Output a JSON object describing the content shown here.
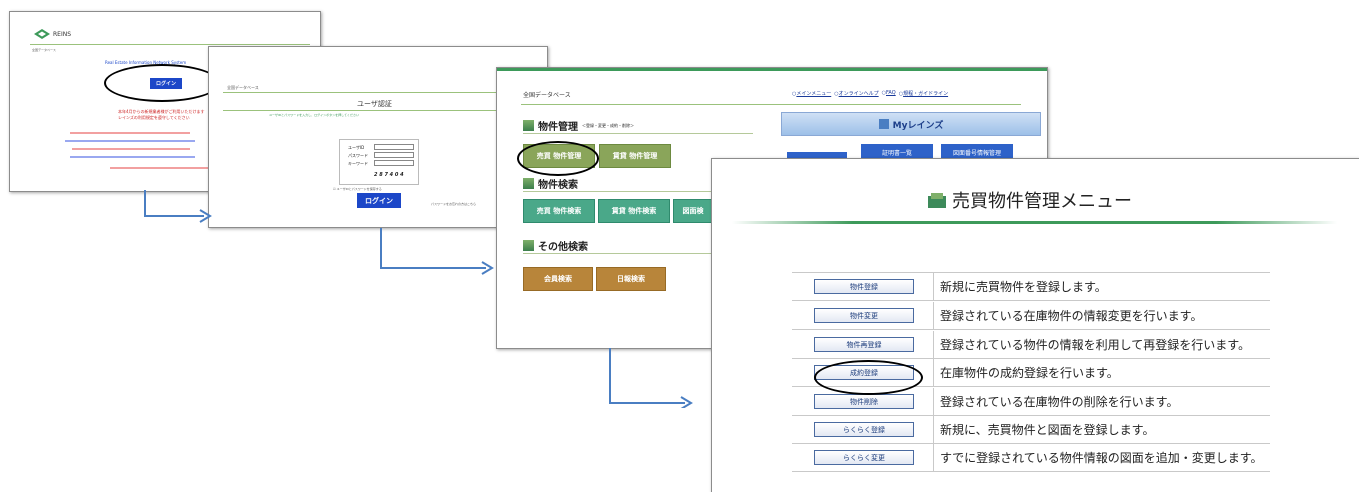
{
  "screen1": {
    "logo": "REINS",
    "header_left": "全国データベース",
    "login_button": "ログイン",
    "body_lines": [
      "Real Estate Information Network System",
      "本年4月からの新規業者様がご利用いただけます",
      "レインズの利用規定を遵守してください"
    ]
  },
  "screen2": {
    "header_left": "全国データベース",
    "title": "ユーザ認証",
    "instruction": "ユーザIDとパスワードを入力し、ログインボタンを押してください",
    "user_id_label": "ユーザID",
    "password_label": "パスワード",
    "keyword_label": "キーワード",
    "captcha": "2 8 7 4 0 4",
    "remember_label": "ユーザIDとパスワードを保存する",
    "login_button": "ログイン",
    "footer_note": "パスワードをお忘れの方はこちら"
  },
  "screen3": {
    "header_left": "全国データベース",
    "header_links": [
      "メインメニュー",
      "オンラインヘルプ",
      "FAQ",
      "規程・ガイドライン"
    ],
    "section_property_mgmt": "物件管理",
    "section_property_mgmt_sub": "＜登録・変更・成約・削除＞",
    "btn_sale_mgmt": "売買 物件管理",
    "btn_rent_mgmt": "賃貸 物件管理",
    "section_search": "物件検索",
    "btn_sale_search": "売買 物件検索",
    "btn_rent_search": "賃貸 物件検索",
    "btn_map_search": "図面検",
    "section_other": "その他検索",
    "btn_member_search": "会員検索",
    "btn_daily_search": "日報検索",
    "my_reins_title": "Myレインズ",
    "my_btn_1": "証明書一覧",
    "my_btn_2": "図面番号情報管理"
  },
  "screen4": {
    "title": "売買物件管理メニュー",
    "rows": [
      {
        "button": "物件登録",
        "desc": "新規に売買物件を登録します。"
      },
      {
        "button": "物件変更",
        "desc": "登録されている在庫物件の情報変更を行います。"
      },
      {
        "button": "物件再登録",
        "desc": "登録されている物件の情報を利用して再登録を行います。"
      },
      {
        "button": "成約登録",
        "desc": "在庫物件の成約登録を行います。"
      },
      {
        "button": "物件削除",
        "desc": "登録されている在庫物件の削除を行います。"
      },
      {
        "button": "らくらく登録",
        "desc": "新規に、売買物件と図面を登録します。"
      },
      {
        "button": "らくらく変更",
        "desc": "すでに登録されている物件情報の図面を追加・変更します。"
      }
    ]
  },
  "colors": {
    "arrow": "#4a7ec2",
    "reins_green": "#3d9a5a",
    "login_blue": "#1c47c8"
  }
}
